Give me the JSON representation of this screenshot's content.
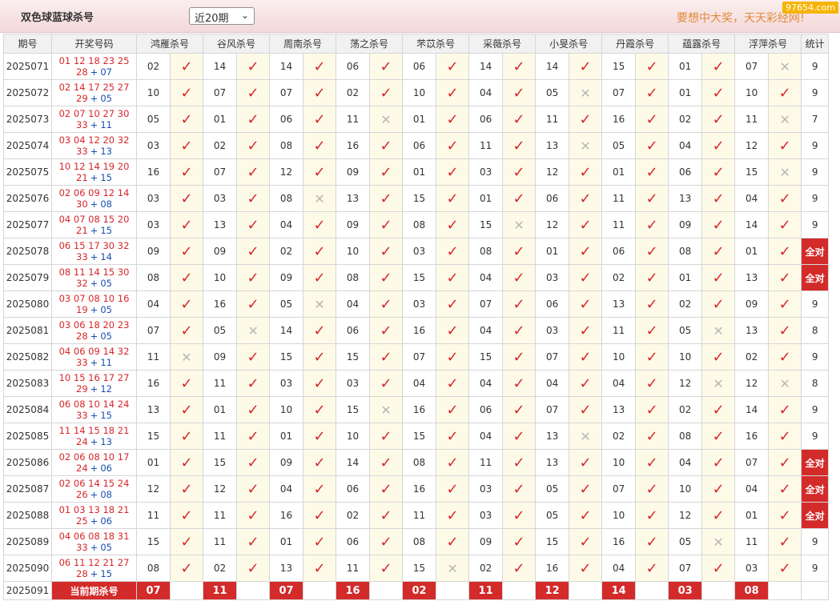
{
  "header": {
    "title": "双色球蓝球杀号",
    "select_value": "近20期",
    "slogan": "要想中大奖，天天彩经网!",
    "watermark": "97654.com"
  },
  "columns": [
    "期号",
    "开奖号码",
    "鸿雁杀号",
    "谷风杀号",
    "周南杀号",
    "荡之杀号",
    "芣苡杀号",
    "采薇杀号",
    "小旻杀号",
    "丹霞杀号",
    "蕴露杀号",
    "浮萍杀号",
    "统计"
  ],
  "rows": [
    {
      "issue": "2025071",
      "red": "01 12 18 23 25",
      "line2": "28",
      "blue": "07",
      "kills": [
        [
          "02",
          1
        ],
        [
          "14",
          1
        ],
        [
          "14",
          1
        ],
        [
          "06",
          1
        ],
        [
          "06",
          1
        ],
        [
          "14",
          1
        ],
        [
          "14",
          1
        ],
        [
          "15",
          1
        ],
        [
          "01",
          1
        ],
        [
          "07",
          0
        ]
      ],
      "stat": "9"
    },
    {
      "issue": "2025072",
      "red": "02 14 17 25 27",
      "line2": "29",
      "blue": "05",
      "kills": [
        [
          "10",
          1
        ],
        [
          "07",
          1
        ],
        [
          "07",
          1
        ],
        [
          "02",
          1
        ],
        [
          "10",
          1
        ],
        [
          "04",
          1
        ],
        [
          "05",
          0
        ],
        [
          "07",
          1
        ],
        [
          "01",
          1
        ],
        [
          "10",
          1
        ]
      ],
      "stat": "9"
    },
    {
      "issue": "2025073",
      "red": "02 07 10 27 30",
      "line2": "33",
      "blue": "11",
      "kills": [
        [
          "05",
          1
        ],
        [
          "01",
          1
        ],
        [
          "06",
          1
        ],
        [
          "11",
          0
        ],
        [
          "01",
          1
        ],
        [
          "06",
          1
        ],
        [
          "11",
          1
        ],
        [
          "16",
          1
        ],
        [
          "02",
          1
        ],
        [
          "11",
          0
        ]
      ],
      "stat": "7"
    },
    {
      "issue": "2025074",
      "red": "03 04 12 20 32",
      "line2": "33",
      "blue": "13",
      "kills": [
        [
          "03",
          1
        ],
        [
          "02",
          1
        ],
        [
          "08",
          1
        ],
        [
          "16",
          1
        ],
        [
          "06",
          1
        ],
        [
          "11",
          1
        ],
        [
          "13",
          0
        ],
        [
          "05",
          1
        ],
        [
          "04",
          1
        ],
        [
          "12",
          1
        ]
      ],
      "stat": "9"
    },
    {
      "issue": "2025075",
      "red": "10 12 14 19 20",
      "line2": "21",
      "blue": "15",
      "kills": [
        [
          "16",
          1
        ],
        [
          "07",
          1
        ],
        [
          "12",
          1
        ],
        [
          "09",
          1
        ],
        [
          "01",
          1
        ],
        [
          "03",
          1
        ],
        [
          "12",
          1
        ],
        [
          "01",
          1
        ],
        [
          "06",
          1
        ],
        [
          "15",
          0
        ]
      ],
      "stat": "9"
    },
    {
      "issue": "2025076",
      "red": "02 06 09 12 14",
      "line2": "30",
      "blue": "08",
      "kills": [
        [
          "03",
          1
        ],
        [
          "03",
          1
        ],
        [
          "08",
          0
        ],
        [
          "13",
          1
        ],
        [
          "15",
          1
        ],
        [
          "01",
          1
        ],
        [
          "06",
          1
        ],
        [
          "11",
          1
        ],
        [
          "13",
          1
        ],
        [
          "04",
          1
        ]
      ],
      "stat": "9"
    },
    {
      "issue": "2025077",
      "red": "04 07 08 15 20",
      "line2": "21",
      "blue": "15",
      "kills": [
        [
          "03",
          1
        ],
        [
          "13",
          1
        ],
        [
          "04",
          1
        ],
        [
          "09",
          1
        ],
        [
          "08",
          1
        ],
        [
          "15",
          0
        ],
        [
          "12",
          1
        ],
        [
          "11",
          1
        ],
        [
          "09",
          1
        ],
        [
          "14",
          1
        ]
      ],
      "stat": "9"
    },
    {
      "issue": "2025078",
      "red": "06 15 17 30 32",
      "line2": "33",
      "blue": "14",
      "kills": [
        [
          "09",
          1
        ],
        [
          "09",
          1
        ],
        [
          "02",
          1
        ],
        [
          "10",
          1
        ],
        [
          "03",
          1
        ],
        [
          "08",
          1
        ],
        [
          "01",
          1
        ],
        [
          "06",
          1
        ],
        [
          "08",
          1
        ],
        [
          "01",
          1
        ]
      ],
      "stat": "全对"
    },
    {
      "issue": "2025079",
      "red": "08 11 14 15 30",
      "line2": "32",
      "blue": "05",
      "kills": [
        [
          "08",
          1
        ],
        [
          "10",
          1
        ],
        [
          "09",
          1
        ],
        [
          "08",
          1
        ],
        [
          "15",
          1
        ],
        [
          "04",
          1
        ],
        [
          "03",
          1
        ],
        [
          "02",
          1
        ],
        [
          "01",
          1
        ],
        [
          "13",
          1
        ]
      ],
      "stat": "全对"
    },
    {
      "issue": "2025080",
      "red": "03 07 08 10 16",
      "line2": "19",
      "blue": "05",
      "kills": [
        [
          "04",
          1
        ],
        [
          "16",
          1
        ],
        [
          "05",
          0
        ],
        [
          "04",
          1
        ],
        [
          "03",
          1
        ],
        [
          "07",
          1
        ],
        [
          "06",
          1
        ],
        [
          "13",
          1
        ],
        [
          "02",
          1
        ],
        [
          "09",
          1
        ]
      ],
      "stat": "9"
    },
    {
      "issue": "2025081",
      "red": "03 06 18 20 23",
      "line2": "28",
      "blue": "05",
      "kills": [
        [
          "07",
          1
        ],
        [
          "05",
          0
        ],
        [
          "14",
          1
        ],
        [
          "06",
          1
        ],
        [
          "16",
          1
        ],
        [
          "04",
          1
        ],
        [
          "03",
          1
        ],
        [
          "11",
          1
        ],
        [
          "05",
          0
        ],
        [
          "13",
          1
        ]
      ],
      "stat": "8"
    },
    {
      "issue": "2025082",
      "red": "04 06 09 14 32",
      "line2": "33",
      "blue": "11",
      "kills": [
        [
          "11",
          0
        ],
        [
          "09",
          1
        ],
        [
          "15",
          1
        ],
        [
          "15",
          1
        ],
        [
          "07",
          1
        ],
        [
          "15",
          1
        ],
        [
          "07",
          1
        ],
        [
          "10",
          1
        ],
        [
          "10",
          1
        ],
        [
          "02",
          1
        ]
      ],
      "stat": "9"
    },
    {
      "issue": "2025083",
      "red": "10 15 16 17 27",
      "line2": "29",
      "blue": "12",
      "kills": [
        [
          "16",
          1
        ],
        [
          "11",
          1
        ],
        [
          "03",
          1
        ],
        [
          "03",
          1
        ],
        [
          "04",
          1
        ],
        [
          "04",
          1
        ],
        [
          "04",
          1
        ],
        [
          "04",
          1
        ],
        [
          "12",
          0
        ],
        [
          "12",
          0
        ]
      ],
      "stat": "8"
    },
    {
      "issue": "2025084",
      "red": "06 08 10 14 24",
      "line2": "33",
      "blue": "15",
      "kills": [
        [
          "13",
          1
        ],
        [
          "01",
          1
        ],
        [
          "10",
          1
        ],
        [
          "15",
          0
        ],
        [
          "16",
          1
        ],
        [
          "06",
          1
        ],
        [
          "07",
          1
        ],
        [
          "13",
          1
        ],
        [
          "02",
          1
        ],
        [
          "14",
          1
        ]
      ],
      "stat": "9"
    },
    {
      "issue": "2025085",
      "red": "11 14 15 18 21",
      "line2": "24",
      "blue": "13",
      "kills": [
        [
          "15",
          1
        ],
        [
          "11",
          1
        ],
        [
          "01",
          1
        ],
        [
          "10",
          1
        ],
        [
          "15",
          1
        ],
        [
          "04",
          1
        ],
        [
          "13",
          0
        ],
        [
          "02",
          1
        ],
        [
          "08",
          1
        ],
        [
          "16",
          1
        ]
      ],
      "stat": "9"
    },
    {
      "issue": "2025086",
      "red": "02 06 08 10 17",
      "line2": "24",
      "blue": "06",
      "kills": [
        [
          "01",
          1
        ],
        [
          "15",
          1
        ],
        [
          "09",
          1
        ],
        [
          "14",
          1
        ],
        [
          "08",
          1
        ],
        [
          "11",
          1
        ],
        [
          "13",
          1
        ],
        [
          "10",
          1
        ],
        [
          "04",
          1
        ],
        [
          "07",
          1
        ]
      ],
      "stat": "全对"
    },
    {
      "issue": "2025087",
      "red": "02 06 14 15 24",
      "line2": "26",
      "blue": "08",
      "kills": [
        [
          "12",
          1
        ],
        [
          "12",
          1
        ],
        [
          "04",
          1
        ],
        [
          "06",
          1
        ],
        [
          "16",
          1
        ],
        [
          "03",
          1
        ],
        [
          "05",
          1
        ],
        [
          "07",
          1
        ],
        [
          "10",
          1
        ],
        [
          "04",
          1
        ]
      ],
      "stat": "全对"
    },
    {
      "issue": "2025088",
      "red": "01 03 13 18 21",
      "line2": "25",
      "blue": "06",
      "kills": [
        [
          "11",
          1
        ],
        [
          "11",
          1
        ],
        [
          "16",
          1
        ],
        [
          "02",
          1
        ],
        [
          "11",
          1
        ],
        [
          "03",
          1
        ],
        [
          "05",
          1
        ],
        [
          "10",
          1
        ],
        [
          "12",
          1
        ],
        [
          "01",
          1
        ]
      ],
      "stat": "全对"
    },
    {
      "issue": "2025089",
      "red": "04 06 08 18 31",
      "line2": "33",
      "blue": "05",
      "kills": [
        [
          "15",
          1
        ],
        [
          "11",
          1
        ],
        [
          "01",
          1
        ],
        [
          "06",
          1
        ],
        [
          "08",
          1
        ],
        [
          "09",
          1
        ],
        [
          "15",
          1
        ],
        [
          "16",
          1
        ],
        [
          "05",
          0
        ],
        [
          "11",
          1
        ]
      ],
      "stat": "9"
    },
    {
      "issue": "2025090",
      "red": "06 11 12 21 27",
      "line2": "28",
      "blue": "15",
      "kills": [
        [
          "08",
          1
        ],
        [
          "02",
          1
        ],
        [
          "13",
          1
        ],
        [
          "11",
          1
        ],
        [
          "15",
          0
        ],
        [
          "02",
          1
        ],
        [
          "16",
          1
        ],
        [
          "04",
          1
        ],
        [
          "07",
          1
        ],
        [
          "03",
          1
        ]
      ],
      "stat": "9"
    }
  ],
  "current": {
    "issue": "2025091",
    "label": "当前期杀号",
    "kills": [
      "07",
      "11",
      "07",
      "16",
      "02",
      "11",
      "12",
      "14",
      "03",
      "08"
    ]
  },
  "symbols": {
    "ok": "✓",
    "no": "✕",
    "plus": "+"
  }
}
